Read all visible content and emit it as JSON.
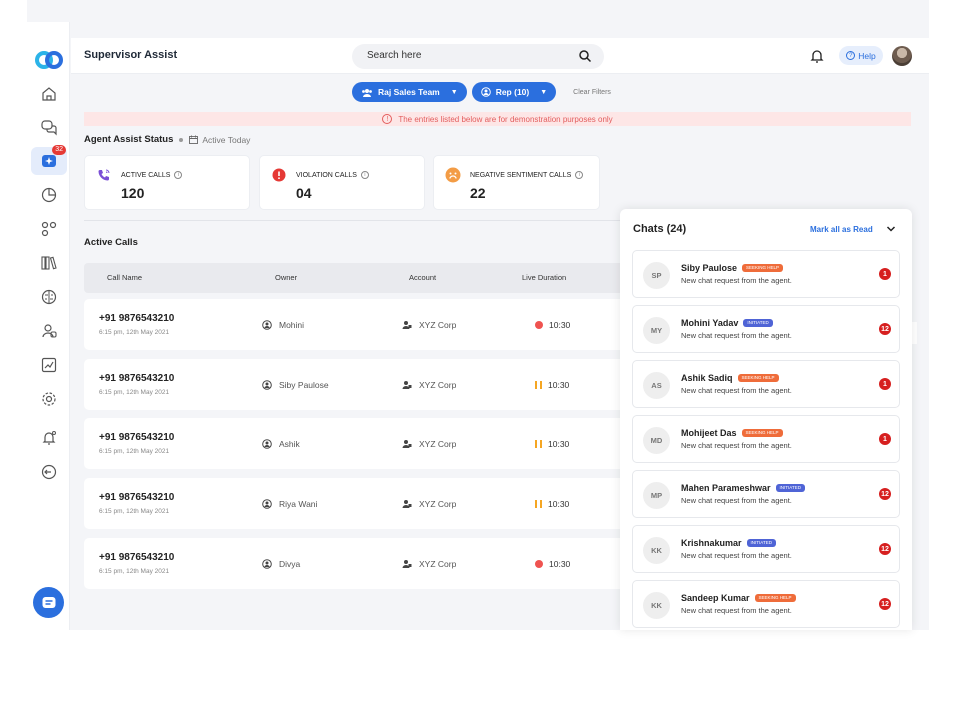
{
  "header": {
    "app_title": "Supervisor Assist",
    "search_placeholder": "Search here",
    "help_label": "Help"
  },
  "sidebar": {
    "badge_count": "32",
    "items": [
      "home",
      "conversations",
      "supervisor-assist",
      "analytics",
      "integrations",
      "library",
      "ai-brain",
      "users",
      "reports",
      "settings",
      "notifications",
      "logout"
    ]
  },
  "filters": {
    "team": "Raj Sales Team",
    "rep": "Rep (10)",
    "clear": "Clear Filters"
  },
  "banner": {
    "text": "The entries listed below are for demonstration purposes only"
  },
  "status": {
    "title": "Agent Assist Status",
    "period": "Active Today"
  },
  "cards": [
    {
      "label": "ACTIVE CALLS",
      "value": "120",
      "color": "#7b4fd6"
    },
    {
      "label": "VIOLATION CALLS",
      "value": "04",
      "color": "#e53935"
    },
    {
      "label": "NEGATIVE SENTIMENT CALLS",
      "value": "22",
      "color": "#f39c45"
    }
  ],
  "active_calls": {
    "title": "Active Calls",
    "columns": [
      "Call Name",
      "Owner",
      "Account",
      "Live Duration"
    ],
    "rows": [
      {
        "phone": "+91 9876543210",
        "time": "6:15 pm, 12th May 2021",
        "owner": "Mohini",
        "account": "XYZ Corp",
        "duration": "10:30",
        "state": "recording"
      },
      {
        "phone": "+91 9876543210",
        "time": "6:15 pm, 12th May 2021",
        "owner": "Siby Paulose",
        "account": "XYZ Corp",
        "duration": "10:30",
        "state": "paused"
      },
      {
        "phone": "+91 9876543210",
        "time": "6:15 pm, 12th May 2021",
        "owner": "Ashik",
        "account": "XYZ Corp",
        "duration": "10:30",
        "state": "paused"
      },
      {
        "phone": "+91 9876543210",
        "time": "6:15 pm, 12th May 2021",
        "owner": "Riya Wani",
        "account": "XYZ Corp",
        "duration": "10:30",
        "state": "paused"
      },
      {
        "phone": "+91 9876543210",
        "time": "6:15 pm, 12th May 2021",
        "owner": "Divya",
        "account": "XYZ Corp",
        "duration": "10:30",
        "state": "recording"
      }
    ]
  },
  "chats": {
    "title": "Chats (24)",
    "mark_all": "Mark all as Read",
    "items": [
      {
        "initials": "SP",
        "name": "Siby Paulose",
        "tag": "SEEKING HELP",
        "tag_type": "seeking",
        "message": "New chat request from the agent.",
        "unread": "1"
      },
      {
        "initials": "MY",
        "name": "Mohini Yadav",
        "tag": "INITIATED",
        "tag_type": "initiated",
        "message": "New chat request from the agent.",
        "unread": "12"
      },
      {
        "initials": "AS",
        "name": "Ashik Sadiq",
        "tag": "SEEKING HELP",
        "tag_type": "seeking",
        "message": "New chat request from the agent.",
        "unread": "1"
      },
      {
        "initials": "MD",
        "name": "Mohijeet Das",
        "tag": "SEEKING HELP",
        "tag_type": "seeking",
        "message": "New chat request from the agent.",
        "unread": "1"
      },
      {
        "initials": "MP",
        "name": "Mahen Parameshwar",
        "tag": "INITIATED",
        "tag_type": "initiated",
        "message": "New chat request from the agent.",
        "unread": "12"
      },
      {
        "initials": "KK",
        "name": "Krishnakumar",
        "tag": "INITIATED",
        "tag_type": "initiated",
        "message": "New chat request from the agent.",
        "unread": "12"
      },
      {
        "initials": "KK",
        "name": "Sandeep Kumar",
        "tag": "SEEKING HELP",
        "tag_type": "seeking",
        "message": "New chat request from the agent.",
        "unread": "12"
      }
    ]
  },
  "colors": {
    "accent": "#2b6fde",
    "danger": "#d61f1f",
    "seeking": "#ef6c3a",
    "initiated": "#4f64d6"
  }
}
